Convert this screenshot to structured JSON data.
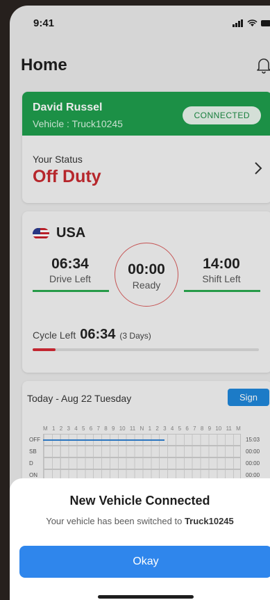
{
  "status_bar": {
    "time": "9:41"
  },
  "header": {
    "title": "Home"
  },
  "driver": {
    "name": "David Russel",
    "vehicle_line": "Vehicle : Truck10245",
    "connection_badge": "CONNECTED",
    "status_label": "Your Status",
    "status_value": "Off Duty"
  },
  "hos": {
    "country": "USA",
    "drive_left_value": "06:34",
    "drive_left_label": "Drive Left",
    "ready_value": "00:00",
    "ready_label": "Ready",
    "shift_left_value": "14:00",
    "shift_left_label": "Shift Left",
    "cycle_label": "Cycle Left",
    "cycle_value": "06:34",
    "cycle_days": "(3 Days)",
    "cycle_progress": 0.1
  },
  "log": {
    "date": "Today - Aug 22 Tuesday",
    "sign_label": "Sign",
    "hours": [
      "M",
      "1",
      "2",
      "3",
      "4",
      "5",
      "6",
      "7",
      "8",
      "9",
      "10",
      "11",
      "N",
      "1",
      "2",
      "3",
      "4",
      "5",
      "6",
      "7",
      "8",
      "9",
      "10",
      "11",
      "M"
    ],
    "rows": [
      {
        "label": "OFF",
        "total": "15:03"
      },
      {
        "label": "SB",
        "total": "00:00"
      },
      {
        "label": "D",
        "total": "00:00"
      },
      {
        "label": "ON",
        "total": "00:00"
      }
    ]
  },
  "modal": {
    "title": "New Vehicle Connected",
    "message": "Your vehicle has been switched to",
    "vehicle": "Truck10245",
    "button_label": "Okay"
  },
  "colors": {
    "accent_green": "#1f9d4c",
    "status_red": "#c62a2f",
    "primary_blue": "#2f86ec"
  }
}
